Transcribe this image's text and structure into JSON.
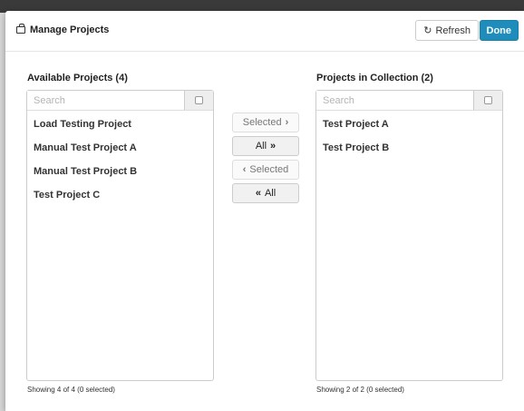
{
  "modal": {
    "title": "Manage Projects",
    "refresh_label": "Refresh",
    "refresh_icon": "↻",
    "done_label": "Done"
  },
  "available": {
    "title": "Available Projects (4)",
    "search_placeholder": "Search",
    "items": [
      "Load Testing Project",
      "Manual Test Project A",
      "Manual Test Project B",
      "Test Project C"
    ],
    "footer": "Showing 4 of 4 (0 selected)"
  },
  "collection": {
    "title": "Projects in Collection (2)",
    "search_placeholder": "Search",
    "items": [
      "Test Project A",
      "Test Project B"
    ],
    "footer": "Showing 2 of 2 (0 selected)"
  },
  "move_buttons": {
    "move_selected": {
      "label": "Selected",
      "glyph": "›"
    },
    "move_all": {
      "label": "All",
      "glyph": "»"
    },
    "remove_selected": {
      "label": "Selected",
      "glyph": "‹"
    },
    "remove_all": {
      "label": "All",
      "glyph": "«"
    }
  },
  "colors": {
    "primary": "#1f8dbb",
    "border": "#cccccc"
  }
}
